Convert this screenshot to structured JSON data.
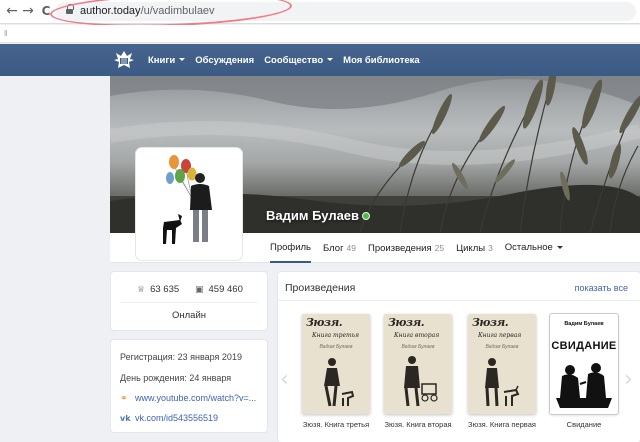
{
  "browser": {
    "url_host": "author.today",
    "url_path": "/u/vadimbulaev",
    "back_glyph": "←",
    "forward_glyph": "→",
    "reload_glyph": "C"
  },
  "site_nav": {
    "items": [
      {
        "label": "Книги",
        "has_caret": true
      },
      {
        "label": "Обсуждения",
        "has_caret": false
      },
      {
        "label": "Сообщество",
        "has_caret": true
      },
      {
        "label": "Моя библиотека",
        "has_caret": false
      }
    ]
  },
  "profile": {
    "name": "Вадим Булаев",
    "online": true,
    "tabs": [
      {
        "label": "Профиль",
        "count": "",
        "active": true
      },
      {
        "label": "Блог",
        "count": "49",
        "active": false
      },
      {
        "label": "Произведения",
        "count": "25",
        "active": false
      },
      {
        "label": "Циклы",
        "count": "3",
        "active": false
      },
      {
        "label": "Остальное",
        "count": "",
        "active": false,
        "has_caret": true
      }
    ]
  },
  "stats": {
    "followers": "63 635",
    "library": "459 460",
    "status": "Онлайн"
  },
  "info": {
    "registration": "Регистрация: 23 января 2019",
    "birthday": "День рождения: 24 января",
    "youtube_link": "www.youtube.com/watch?v=...",
    "vk_link": "vk.com/id543556519"
  },
  "works": {
    "title": "Произведения",
    "show_all": "показать все",
    "books": [
      {
        "title": "Зюзя. Книга третья",
        "cover_title": "Зюзя.",
        "cover_sub": "Книга третья",
        "cover_author": "Вадим Булаев"
      },
      {
        "title": "Зюзя. Книга вторая",
        "cover_title": "Зюзя.",
        "cover_sub": "Книга вторая",
        "cover_author": "Вадим Булаев"
      },
      {
        "title": "Зюзя. Книга первая",
        "cover_title": "Зюзя.",
        "cover_sub": "Книга первая",
        "cover_author": "Вадим Булаев"
      },
      {
        "title": "Свидание",
        "cover_title": "СВИДАНИЕ",
        "cover_sub": "",
        "cover_author": "Вадим Булаев"
      }
    ]
  },
  "colors": {
    "header": "#3d5a80",
    "link": "#3d64b0",
    "online": "#4cbb47",
    "annotation": "#f07a85"
  }
}
